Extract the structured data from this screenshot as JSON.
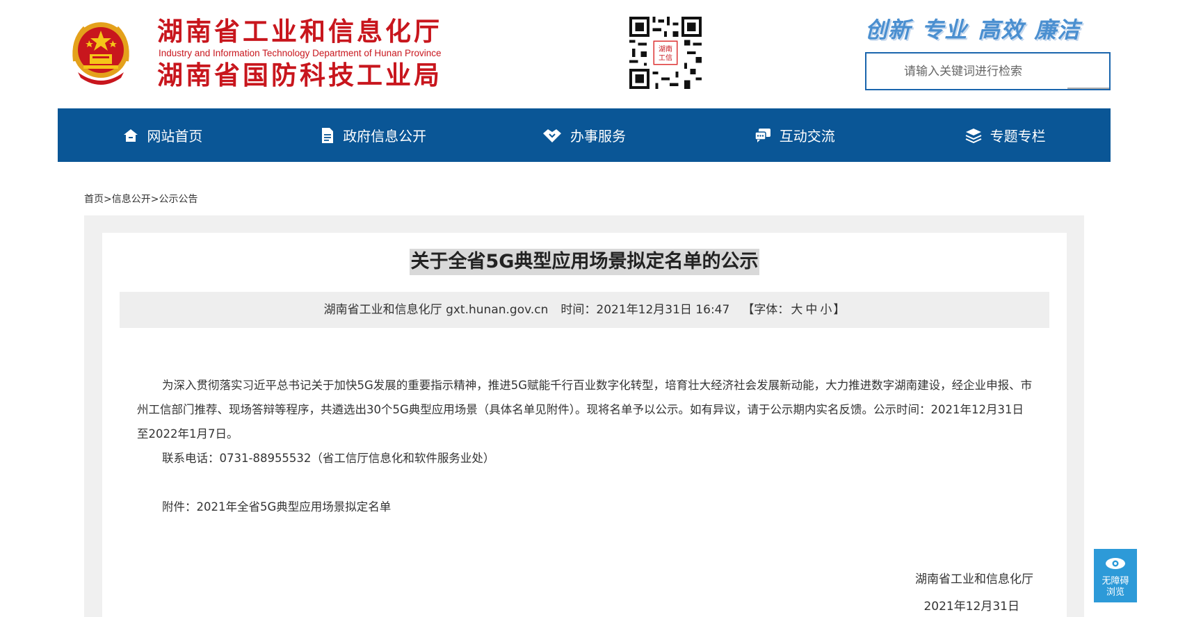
{
  "header": {
    "logo_line1": "湖南省工业和信息化厅",
    "logo_en": "Industry and Information Technology Department of Hunan Province",
    "logo_line2": "湖南省国防科技工业局",
    "slogan": [
      "创新",
      "专业",
      "高效",
      "廉洁"
    ],
    "search_placeholder": "请输入关键词进行检索",
    "brand_red": "#c8161d",
    "emblem_icon": "national-emblem-icon",
    "qr_icon": "qr-code-icon"
  },
  "nav": {
    "background": "#0a5696",
    "items": [
      {
        "label": "网站首页",
        "icon": "home-icon"
      },
      {
        "label": "政府信息公开",
        "icon": "document-icon"
      },
      {
        "label": "办事服务",
        "icon": "handshake-icon"
      },
      {
        "label": "互动交流",
        "icon": "chat-icon"
      },
      {
        "label": "专题专栏",
        "icon": "layers-icon"
      }
    ]
  },
  "breadcrumb": {
    "home": "首页",
    "sep1": ">",
    "level1": "信息公开",
    "sep2": ">",
    "level2": "公示公告"
  },
  "article": {
    "title": "关于全省5G典型应用场景拟定名单的公示",
    "source": "湖南省工业和信息化厅 gxt.hunan.gov.cn",
    "time_label": "时间：",
    "time_value": "2021年12月31日 16:47",
    "font_label": "【字体：",
    "font_large": "大",
    "font_medium": "中",
    "font_small": "小",
    "font_close": "】",
    "paragraph1": "为深入贯彻落实习近平总书记关于加快5G发展的重要指示精神，推进5G赋能千行百业数字化转型，培育壮大经济社会发展新动能，大力推进数字湖南建设，经企业申报、市州工信部门推荐、现场答辩等程序，共遴选出30个5G典型应用场景（具体名单见附件）。现将名单予以公示。如有异议，请于公示期内实名反馈。公示时间：2021年12月31日至2022年1月7日。",
    "contact": "联系电话：0731-88955532（省工信厅信息化和软件服务业处）",
    "attachment": "附件：2021年全省5G典型应用场景拟定名单",
    "sign_org": "湖南省工业和信息化厅",
    "sign_date": "2021年12月31日"
  },
  "accessibility": {
    "label_line1": "无障碍",
    "label_line2": "浏览",
    "icon": "eye-icon"
  }
}
